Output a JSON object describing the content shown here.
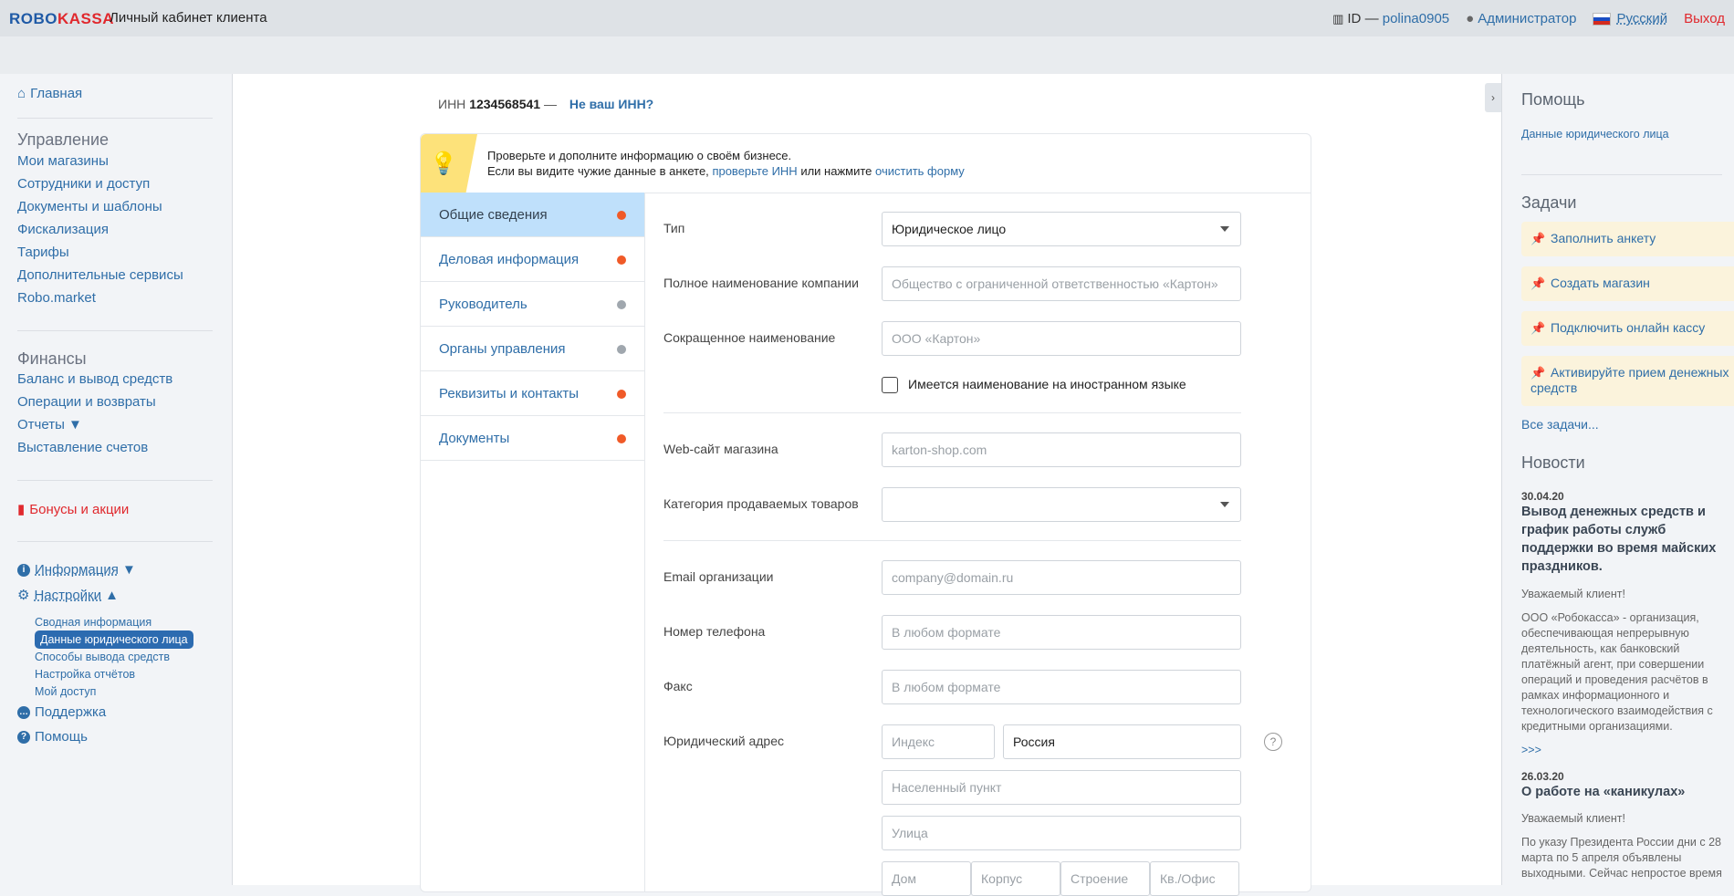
{
  "topbar": {
    "logo_part1": "ROBO",
    "logo_part2": "KASSA",
    "cabinet": "Личный кабинет клиента",
    "id_label": "ID",
    "id_dash": "—",
    "username": "polina0905",
    "role": "Администратор",
    "language": "Русский",
    "logout": "Выход"
  },
  "sidebar": {
    "home": "Главная",
    "management_title": "Управление",
    "management": [
      "Мои магазины",
      "Сотрудники и доступ",
      "Документы и шаблоны",
      "Фискализация",
      "Тарифы",
      "Дополнительные сервисы",
      "Robo.market"
    ],
    "finance_title": "Финансы",
    "finance": [
      "Баланс и вывод средств",
      "Операции и возвраты",
      "Отчеты ▼",
      "Выставление счетов"
    ],
    "bonus": "Бонусы и акции",
    "info": "Информация",
    "settings": "Настройки",
    "settings_sub": [
      "Сводная информация",
      "Данные юридического лица",
      "Способы вывода средств",
      "Настройка отчётов",
      "Мой доступ"
    ],
    "support": "Поддержка",
    "help": "Помощь"
  },
  "main": {
    "inn_label": "ИНН",
    "inn_value": "1234568541",
    "inn_dash": "—",
    "not_your_inn": "Не ваш ИНН?",
    "notice_line1": "Проверьте и дополните информацию о своём бизнесе.",
    "notice_line2_a": "Если вы видите чужие данные в анкете,",
    "notice_link1": "проверьте ИНН",
    "notice_line2_b": "или нажмите",
    "notice_link2": "очистить форму",
    "tabs": [
      {
        "label": "Общие сведения",
        "dot_color": "#f05a28"
      },
      {
        "label": "Деловая информация",
        "dot_color": "#f05a28"
      },
      {
        "label": "Руководитель",
        "dot_color": "#a0a7ae"
      },
      {
        "label": "Органы управления",
        "dot_color": "#a0a7ae"
      },
      {
        "label": "Реквизиты и контакты",
        "dot_color": "#f05a28"
      },
      {
        "label": "Документы",
        "dot_color": "#f05a28"
      }
    ],
    "form": {
      "type_label": "Тип",
      "type_value": "Юридическое лицо",
      "fullname_label": "Полное наименование компании",
      "fullname_placeholder": "Общество с ограниченной ответственностью «Картон»",
      "shortname_label": "Сокращенное наименование",
      "shortname_placeholder": "ООО «Картон»",
      "foreign_name": "Имеется наименование на иностранном языке",
      "website_label": "Web-сайт магазина",
      "website_placeholder": "karton-shop.com",
      "category_label": "Категория продаваемых товаров",
      "email_label": "Email организации",
      "email_placeholder": "company@domain.ru",
      "phone_label": "Номер телефона",
      "phone_placeholder": "В любом формате",
      "fax_label": "Факс",
      "fax_placeholder": "В любом формате",
      "address_label": "Юридический адрес",
      "index_placeholder": "Индекс",
      "country_value": "Россия",
      "city_placeholder": "Населенный пункт",
      "street_placeholder": "Улица",
      "house_placeholder": "Дом",
      "building_placeholder": "Корпус",
      "structure_placeholder": "Строение",
      "flat_placeholder": "Кв./Офис"
    }
  },
  "right": {
    "help_title": "Помощь",
    "help_link": "Данные юридического лица",
    "tasks_title": "Задачи",
    "tasks": [
      "Заполнить анкету",
      "Создать магазин",
      "Подключить онлайн кассу",
      "Активируйте прием денежных средств"
    ],
    "all_tasks": "Все задачи...",
    "news_title": "Новости",
    "news": [
      {
        "date": "30.04.20",
        "title": "Вывод денежных средств и график работы служб поддержки во время майских праздников.",
        "greeting": "Уважаемый клиент!",
        "text": "ООО «Робокасса» - организация, обеспечивающая непрерывную деятельность, как банковский платёжный агент, при совершении операций и проведения расчётов в рамках информационного и технологического взаимодействия с кредитными организациями.",
        "more": ">>>"
      },
      {
        "date": "26.03.20",
        "title": "О работе на «каникулах»",
        "greeting": "Уважаемый клиент!",
        "text": "По указу Президента России дни с 28 марта по 5 апреля объявлены выходными. Сейчас непростое время"
      }
    ]
  }
}
